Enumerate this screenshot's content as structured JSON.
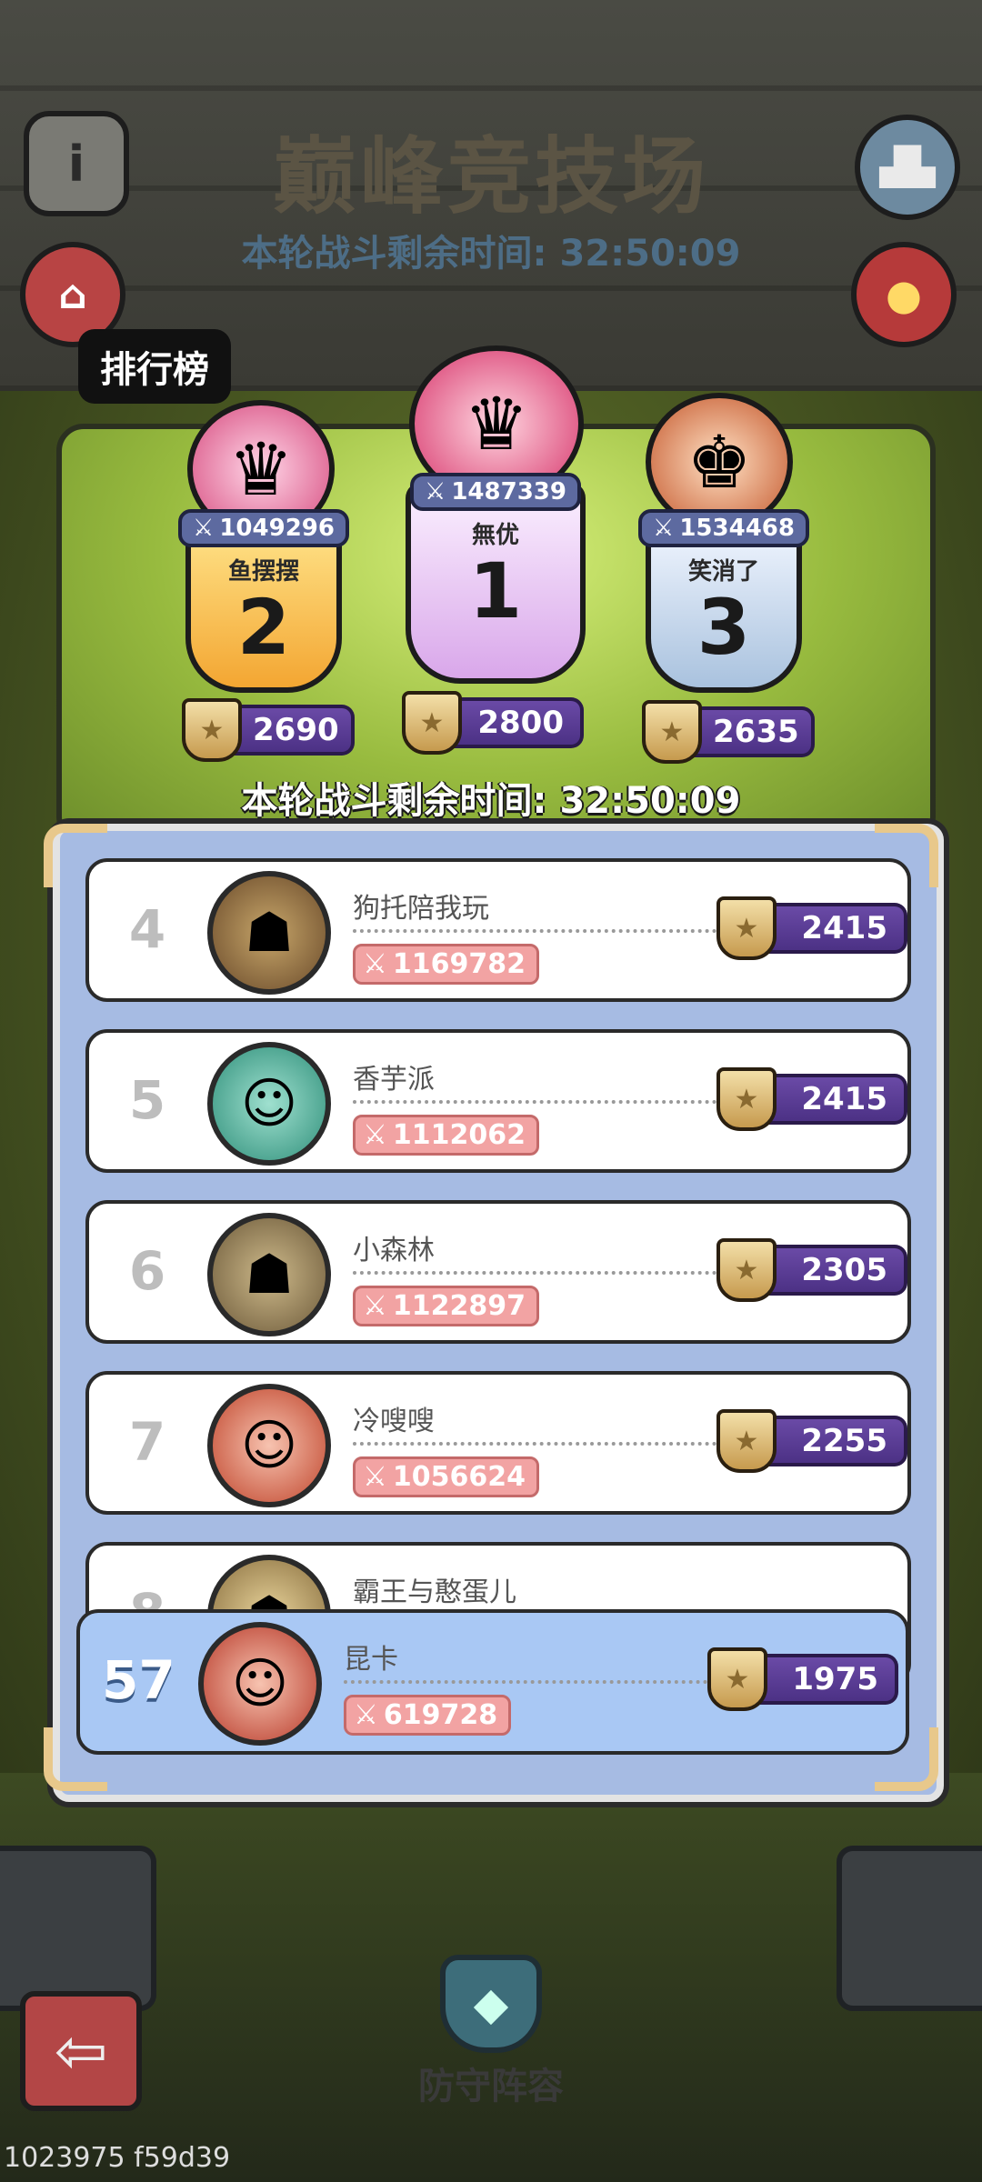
{
  "header": {
    "title": "巅峰竞技场",
    "timer_top": "本轮战斗剩余时间: 32:50:09",
    "ranking_label": "排行榜"
  },
  "podium": [
    {
      "rank": "2",
      "name": "鱼摆摆",
      "power": "1049296",
      "score": "2690"
    },
    {
      "rank": "1",
      "name": "無优",
      "power": "1487339",
      "score": "2800"
    },
    {
      "rank": "3",
      "name": "笑消了",
      "power": "1534468",
      "score": "2635"
    }
  ],
  "timer_mid": "本轮战斗剩余时间: 32:50:09",
  "leaderboard": [
    {
      "rank": "4",
      "name": "狗托陪我玩",
      "power": "1169782",
      "score": "2415"
    },
    {
      "rank": "5",
      "name": "香芋派",
      "power": "1112062",
      "score": "2415"
    },
    {
      "rank": "6",
      "name": "小森林",
      "power": "1122897",
      "score": "2305"
    },
    {
      "rank": "7",
      "name": "冷嗖嗖",
      "power": "1056624",
      "score": "2255"
    },
    {
      "rank": "8",
      "name": "霸王与憨蛋儿",
      "power": "",
      "score": ""
    }
  ],
  "my_entry": {
    "rank": "57",
    "name": "昆卡",
    "power": "619728",
    "score": "1975"
  },
  "footer": {
    "defense_label": "防守阵容",
    "build_id": "1023975 f59d39"
  },
  "icons": {
    "info": "i",
    "power": "⚔",
    "trophy": "★",
    "back": "⇦"
  }
}
